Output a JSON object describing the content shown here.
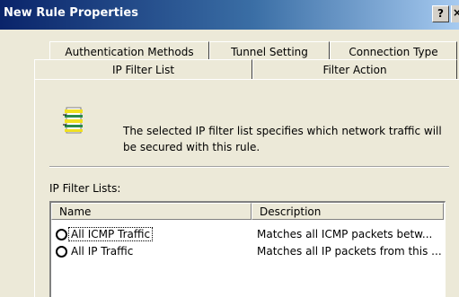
{
  "window": {
    "title": "New Rule Properties",
    "help_label": "?",
    "close_label": "×"
  },
  "tabs_back": [
    {
      "label": "Authentication Methods"
    },
    {
      "label": "Tunnel Setting"
    },
    {
      "label": "Connection Type"
    }
  ],
  "tabs_front": [
    {
      "label": "IP Filter List",
      "selected": true
    },
    {
      "label": "Filter Action",
      "selected": false
    }
  ],
  "info": {
    "icon": "filter-list-icon",
    "text": "The selected IP filter list specifies which network traffic will be secured with this rule."
  },
  "filter_lists": {
    "label": "IP Filter Lists:",
    "columns": [
      "Name",
      "Description"
    ],
    "rows": [
      {
        "name": "All ICMP Traffic",
        "description": "Matches all ICMP packets betw...",
        "selected": false
      },
      {
        "name": "All IP Traffic",
        "description": "Matches all IP packets from this ...",
        "selected": false
      }
    ]
  },
  "colors": {
    "title_start": "#0a246a",
    "title_end": "#a6caf0",
    "face": "#ece9d8",
    "icon_yellow": "#f0e020",
    "icon_green": "#2a8a4a"
  }
}
